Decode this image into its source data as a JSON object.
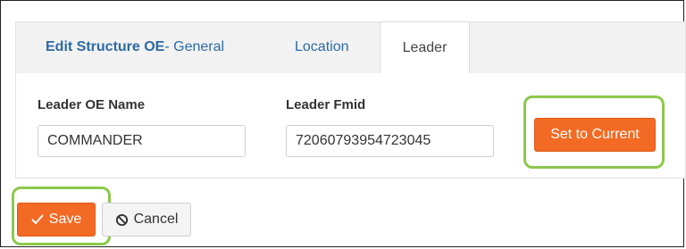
{
  "tabs": {
    "first_bold": "Edit Structure OE",
    "first_rest": " - General",
    "location": "Location",
    "leader": "Leader"
  },
  "form": {
    "leader_oe_name_label": "Leader OE Name",
    "leader_oe_name_value": "COMMANDER",
    "leader_fmid_label": "Leader Fmid",
    "leader_fmid_value": "72060793954723045",
    "set_to_current_label": "Set to Current"
  },
  "actions": {
    "save_label": "Save",
    "cancel_label": "Cancel"
  },
  "colors": {
    "accent_orange": "#f36a24",
    "highlight_green": "#8cc84b",
    "tab_link_blue": "#2d6aa3"
  },
  "icons": {
    "save": "checkmark-icon",
    "cancel": "ban-icon"
  }
}
